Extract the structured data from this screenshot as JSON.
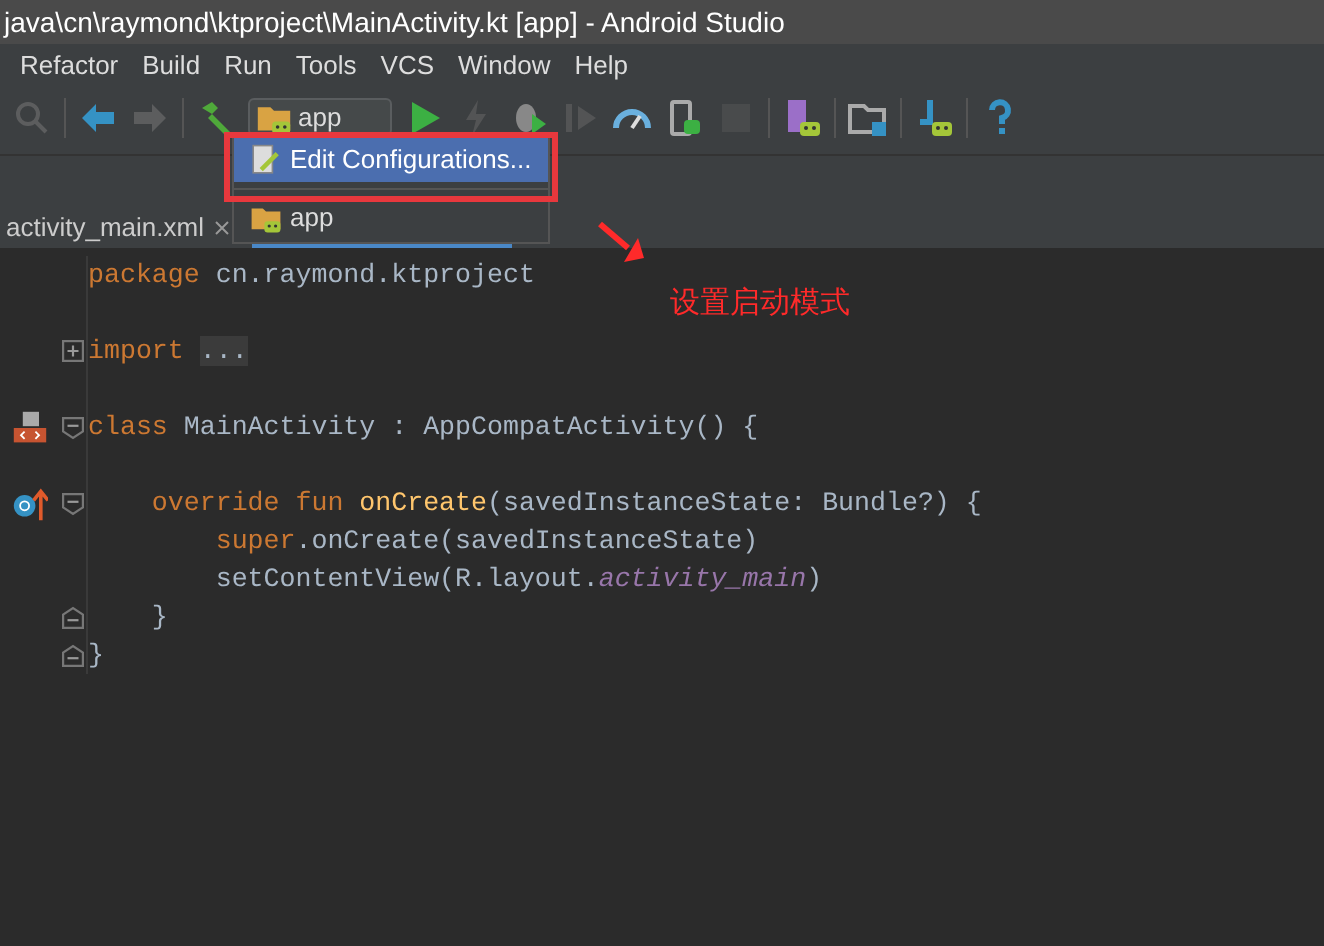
{
  "window": {
    "title": "java\\cn\\raymond\\ktproject\\MainActivity.kt [app] - Android Studio"
  },
  "menu": [
    {
      "label": "Refactor"
    },
    {
      "label": "Build"
    },
    {
      "label": "Run"
    },
    {
      "label": "Tools"
    },
    {
      "label": "VCS"
    },
    {
      "label": "Window"
    },
    {
      "label": "Help"
    }
  ],
  "toolbar": [
    {
      "kind": "find",
      "disabled": true
    },
    {
      "kind": "sep"
    },
    {
      "kind": "back",
      "disabled": false
    },
    {
      "kind": "forward",
      "disabled": true
    },
    {
      "kind": "sep"
    },
    {
      "kind": "hammer",
      "disabled": false
    },
    {
      "kind": "config"
    },
    {
      "kind": "run",
      "disabled": false
    },
    {
      "kind": "bolt",
      "disabled": true
    },
    {
      "kind": "debug",
      "disabled": false
    },
    {
      "kind": "attach",
      "disabled": true
    },
    {
      "kind": "profile",
      "disabled": false
    },
    {
      "kind": "device",
      "disabled": false
    },
    {
      "kind": "stop",
      "disabled": true
    },
    {
      "kind": "sep"
    },
    {
      "kind": "avd",
      "disabled": false
    },
    {
      "kind": "sep"
    },
    {
      "kind": "structure",
      "disabled": false
    },
    {
      "kind": "sep"
    },
    {
      "kind": "sdk",
      "disabled": false
    },
    {
      "kind": "sep"
    },
    {
      "kind": "help",
      "disabled": false
    }
  ],
  "run_config": {
    "value": "app"
  },
  "dropdown": [
    {
      "label": "Edit Configurations...",
      "kind": "edit",
      "selected": true
    },
    {
      "label": "app",
      "kind": "app",
      "selected": false
    }
  ],
  "tabs": [
    {
      "label": "activity_main.xml",
      "selected": false
    }
  ],
  "annotation": {
    "text": "设置启动模式"
  },
  "code": [
    {
      "kind": "text",
      "segments": [
        {
          "text": "package",
          "kind": "keyword"
        },
        {
          "text": " cn.raymond.ktproject",
          "kind": "plain"
        }
      ]
    },
    {
      "kind": "blank"
    },
    {
      "kind": "text",
      "fold": {
        "kind": "plus"
      },
      "segments": [
        {
          "text": "import ",
          "kind": "keyword"
        },
        {
          "text": "...",
          "kind": "folded"
        }
      ]
    },
    {
      "kind": "blank"
    },
    {
      "kind": "text",
      "gutter": {
        "kind": "layout"
      },
      "fold": {
        "kind": "open"
      },
      "segments": [
        {
          "text": "class",
          "kind": "keyword"
        },
        {
          "text": " MainActivity : AppCompatActivity() {",
          "kind": "plain"
        }
      ]
    },
    {
      "kind": "blank"
    },
    {
      "kind": "text",
      "gutter": {
        "kind": "override"
      },
      "fold": {
        "kind": "open"
      },
      "segments": [
        {
          "text": "    override fun ",
          "kind": "keyword"
        },
        {
          "text": "onCreate",
          "kind": "fn"
        },
        {
          "text": "(savedInstanceState: Bundle?) {",
          "kind": "plain"
        }
      ]
    },
    {
      "kind": "text",
      "segments": [
        {
          "text": "        super",
          "kind": "keyword"
        },
        {
          "text": ".onCreate(savedInstanceState)",
          "kind": "plain"
        }
      ]
    },
    {
      "kind": "text",
      "segments": [
        {
          "text": "        setContentView(R.layout.",
          "kind": "plain"
        },
        {
          "text": "activity_main",
          "kind": "italic"
        },
        {
          "text": ")",
          "kind": "plain"
        }
      ]
    },
    {
      "kind": "text",
      "fold": {
        "kind": "close"
      },
      "segments": [
        {
          "text": "    }",
          "kind": "plain"
        }
      ]
    },
    {
      "kind": "text",
      "fold": {
        "kind": "close"
      },
      "segments": [
        {
          "text": "}",
          "kind": "plain"
        }
      ]
    }
  ]
}
